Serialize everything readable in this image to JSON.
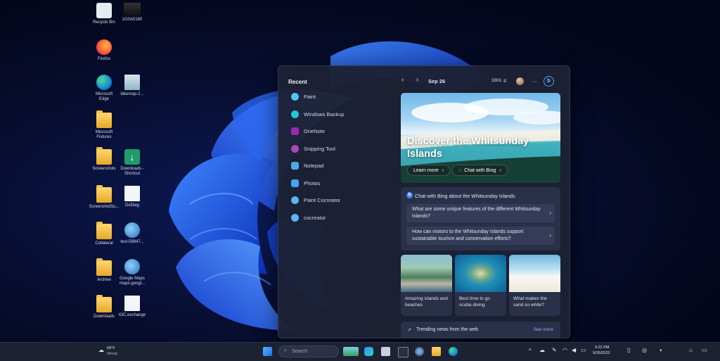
{
  "desktop_icons": [
    {
      "label_lines": [
        "Recycle Bin"
      ],
      "kind": "recycle"
    },
    {
      "label_lines": [
        "1G0A0180"
      ],
      "kind": "photo"
    },
    {
      "label_lines": [
        "Firefox"
      ],
      "kind": "firefox"
    },
    {
      "label_lines": [
        "Microsoft",
        "Edge"
      ],
      "kind": "edge"
    },
    {
      "label_lines": [
        "bikemap-2..."
      ],
      "kind": "doc"
    },
    {
      "label_lines": [
        "Microsoft",
        "Fixtures"
      ],
      "kind": "folder"
    },
    {
      "label_lines": [
        "Downloads -",
        "Shortcut"
      ],
      "kind": "download"
    },
    {
      "label_lines": [
        "Screenshots"
      ],
      "kind": "folder"
    },
    {
      "label_lines": [
        "DxDiag"
      ],
      "kind": "doc"
    },
    {
      "label_lines": [
        "ScreenshotSu..."
      ],
      "kind": "folder"
    },
    {
      "label_lines": [
        "test-59947..."
      ],
      "kind": "globe"
    },
    {
      "label_lines": [
        "Collateral"
      ],
      "kind": "folder"
    },
    {
      "label_lines": [
        "Google Maps",
        "maps.googl..."
      ],
      "kind": "globe"
    },
    {
      "label_lines": [
        "Archive"
      ],
      "kind": "folder"
    },
    {
      "label_lines": [
        "IOC.exchange"
      ],
      "kind": "doc"
    },
    {
      "label_lines": [
        "Downloads"
      ],
      "kind": "folder"
    }
  ],
  "panel": {
    "recent_title": "Recent",
    "recent_items": [
      {
        "label": "Paint",
        "icon": "paint-icon",
        "color": "#4fc3f7"
      },
      {
        "label": "Windows Backup",
        "icon": "backup-icon",
        "color": "#26c6da"
      },
      {
        "label": "OneNote",
        "icon": "onenote-icon",
        "color": "#9c27b0"
      },
      {
        "label": "Snipping Tool",
        "icon": "snipping-icon",
        "color": "#ab47bc"
      },
      {
        "label": "Notepad",
        "icon": "notepad-icon",
        "color": "#4fa8e8"
      },
      {
        "label": "Photos",
        "icon": "photos-icon",
        "color": "#42a5f5"
      },
      {
        "label": "Paint Cocreator",
        "icon": "cocreator-icon",
        "color": "#5fb4f0"
      },
      {
        "label": "cocreator",
        "icon": "cocreator-icon",
        "color": "#5fb4f0"
      }
    ],
    "feed": {
      "date": "Sep 26",
      "points": "3301",
      "more": "···",
      "hero_title": "Discover the Whitsunday Islands",
      "learn_more": "Learn more",
      "chat_with_bing": "Chat with Bing",
      "chat_card_title": "Chat with Bing about the Whitsunday Islands",
      "questions": [
        "What are some unique features of the different Whitsunday Islands?",
        "How can visitors to the Whitsunday Islands support sustainable tourism and conservation efforts?"
      ],
      "thumbs": [
        {
          "caption": "Amazing islands and beaches"
        },
        {
          "caption": "Best time to go scuba diving"
        },
        {
          "caption": "What makes the sand so white?"
        }
      ],
      "trending_title": "Trending news from the web",
      "see_more": "See more"
    }
  },
  "taskbar": {
    "weather_temp": "69°F",
    "weather_desc": "Windy",
    "search_placeholder": "Search",
    "time": "4:22 PM",
    "date": "9/26/2023"
  }
}
